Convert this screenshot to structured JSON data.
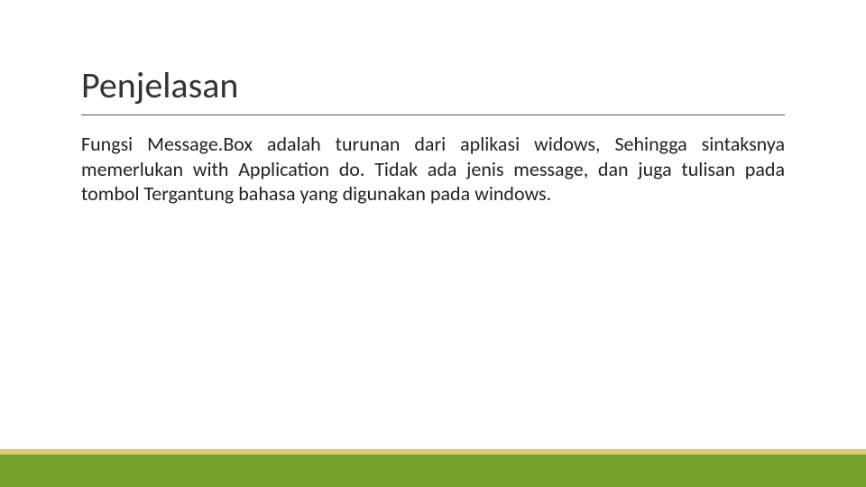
{
  "slide": {
    "title": "Penjelasan",
    "body": "Fungsi Message.Box adalah turunan dari aplikasi widows, Sehingga sintaksnya memerlukan with Application do. Tidak ada jenis message, dan juga tulisan pada tombol  Tergantung bahasa yang digunakan pada windows."
  }
}
